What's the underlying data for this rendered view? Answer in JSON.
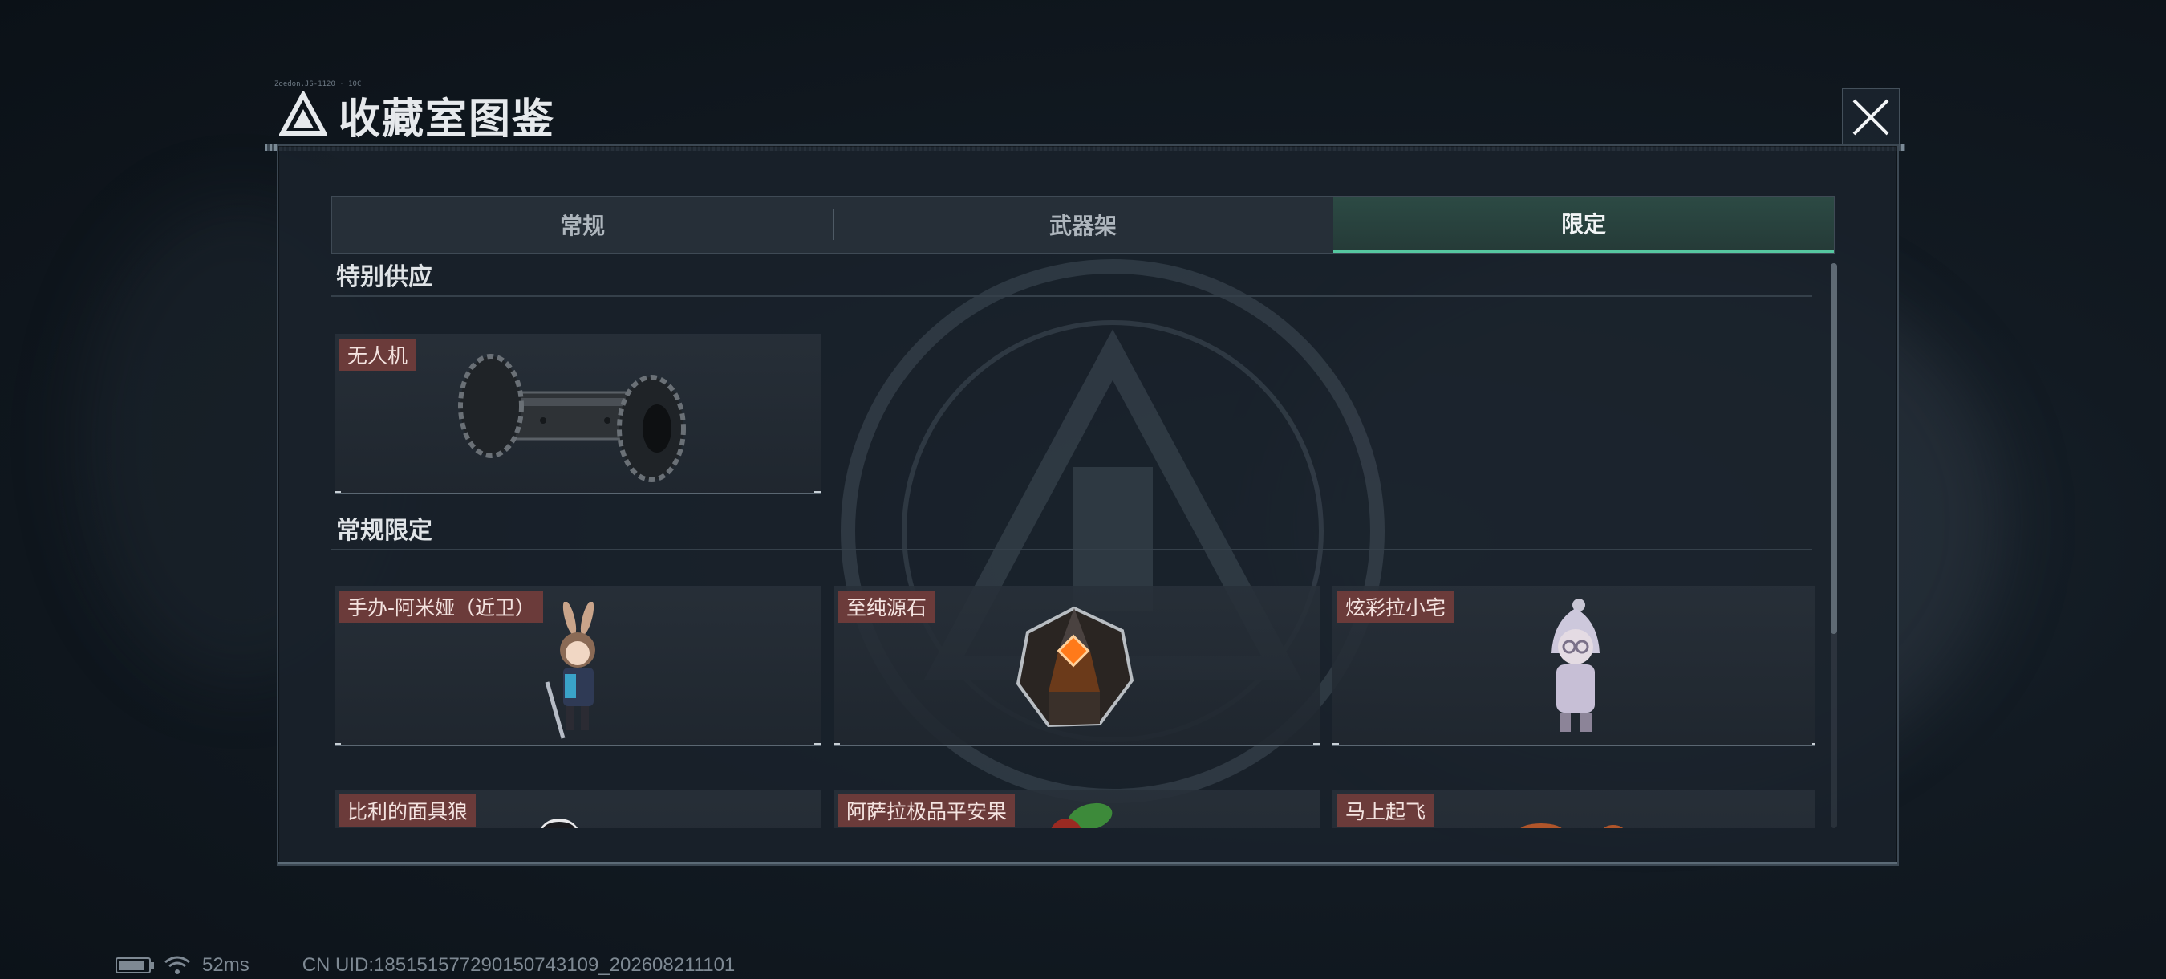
{
  "header": {
    "title": "收藏室图鉴",
    "micro_text": "Zoedon.JS-1120 · 10C"
  },
  "tabs": [
    {
      "label": "常规",
      "active": false
    },
    {
      "label": "武器架",
      "active": false
    },
    {
      "label": "限定",
      "active": true
    }
  ],
  "sections": [
    {
      "title": "特别供应",
      "items": [
        {
          "label": "无人机",
          "icon": "drone-roller-icon"
        }
      ]
    },
    {
      "title": "常规限定",
      "items": [
        {
          "label": "手办-阿米娅（近卫）",
          "icon": "amiya-figure-icon"
        },
        {
          "label": "至纯源石",
          "icon": "originium-crystal-icon"
        },
        {
          "label": "炫彩拉小宅",
          "icon": "hooded-figure-icon"
        },
        {
          "label": "比利的面具狼",
          "icon": "masked-wolf-icon"
        },
        {
          "label": "阿萨拉极品平安果",
          "icon": "apple-icon"
        },
        {
          "label": "马上起飞",
          "icon": "horse-icon"
        }
      ]
    }
  ],
  "status": {
    "ping": "52ms",
    "uid": "CN UID:18515157729015074310​9_202608211101"
  },
  "colors": {
    "accent": "#56c7a0",
    "label_bg": "#6b3b3a",
    "panel_bg": "#1a222b"
  }
}
